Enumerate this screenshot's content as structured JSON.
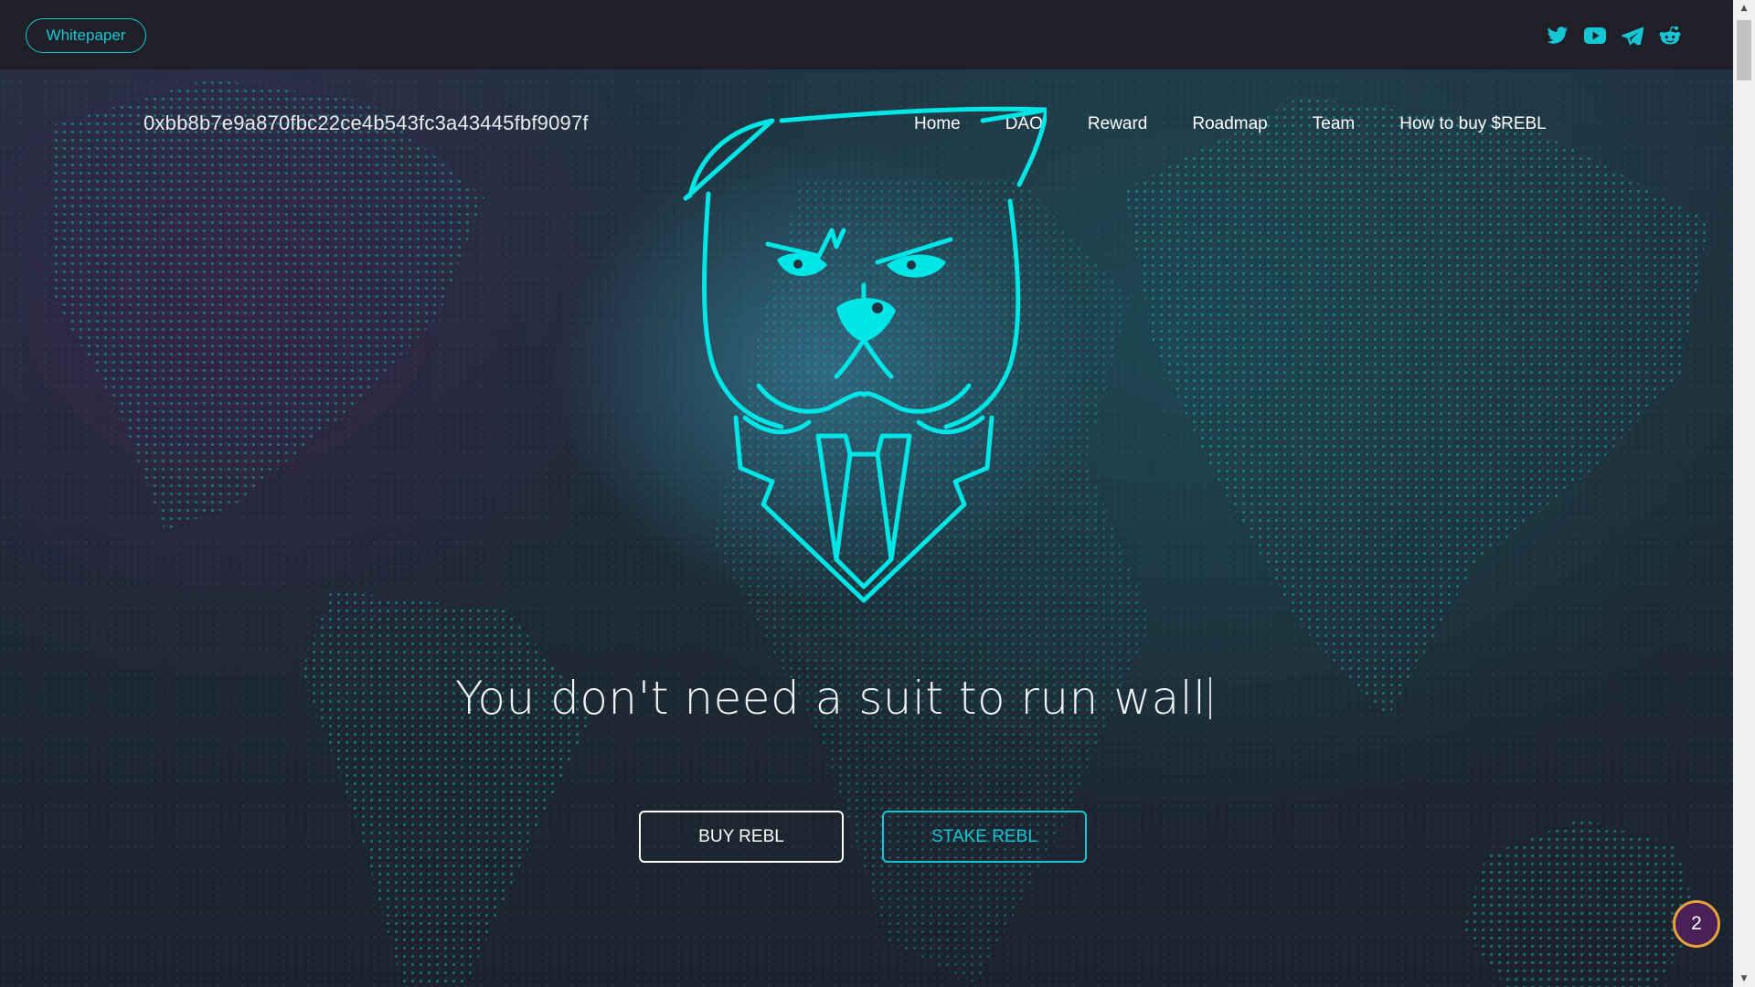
{
  "topbar": {
    "whitepaper_label": "Whitepaper",
    "socials": [
      "twitter-icon",
      "youtube-icon",
      "telegram-icon",
      "reddit-icon"
    ]
  },
  "header": {
    "contract_address": "0xbb8b7e9a870fbc22ce4b543fc3a43445fbf9097f",
    "nav": [
      "Home",
      "DAO",
      "Reward",
      "Roadmap",
      "Team",
      "How to buy $REBL"
    ]
  },
  "hero": {
    "tagline": "You don't need a suit to run wall",
    "buy_label": "BUY REBL",
    "stake_label": "STAKE REBL"
  },
  "notification": {
    "count": "2"
  },
  "colors": {
    "accent": "#14c6d6",
    "logo": "#00e5e5",
    "badge_border": "#e8a23a",
    "badge_bg": "#4b1f57"
  }
}
